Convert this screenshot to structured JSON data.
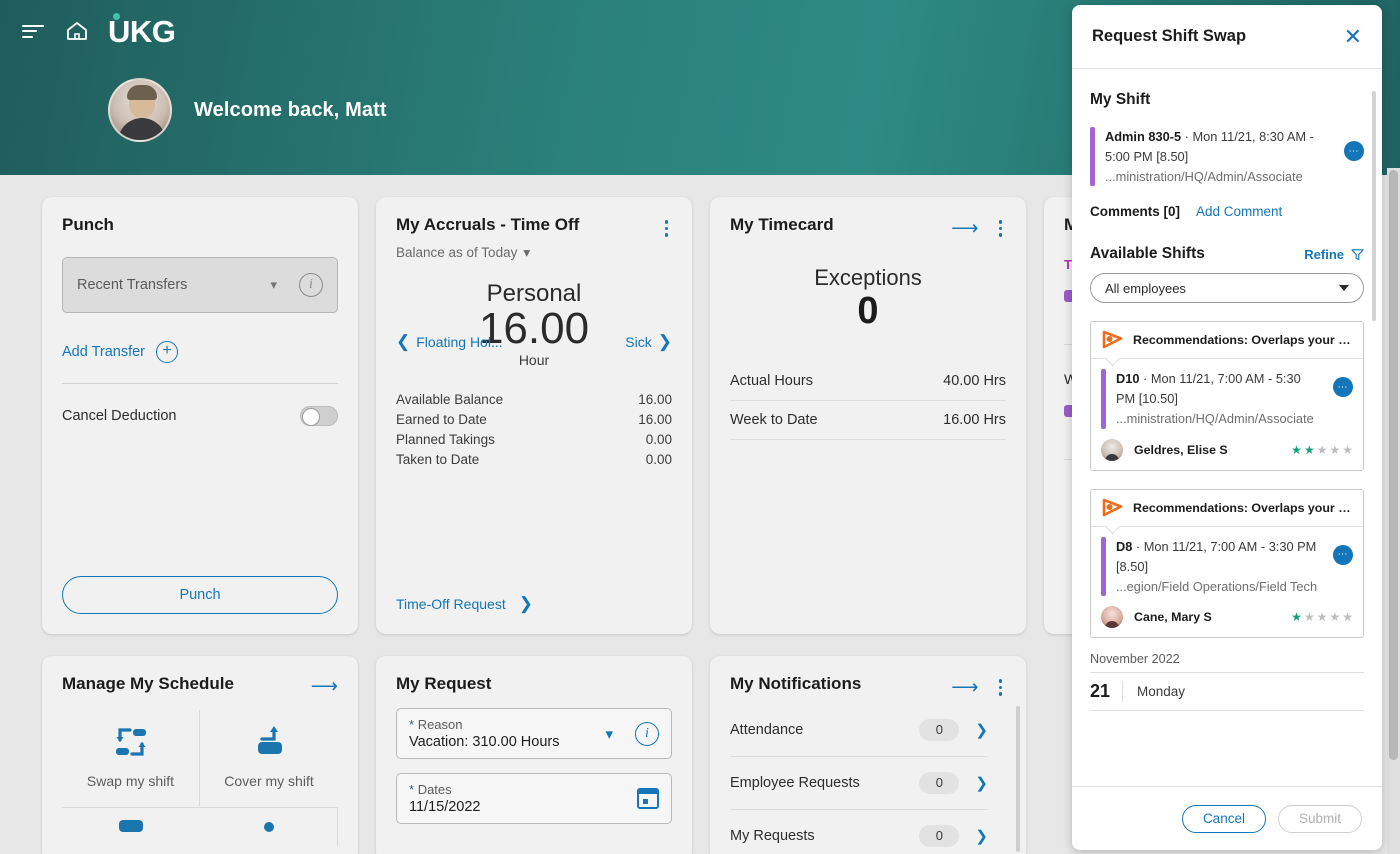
{
  "header": {
    "logo": "UKG",
    "menu_icon": "hamburger-icon",
    "home_icon": "home-icon",
    "welcome": "Welcome back, Matt"
  },
  "cards": {
    "punch": {
      "title": "Punch",
      "transfer_select": "Recent Transfers",
      "add_transfer": "Add Transfer",
      "cancel_deduction": "Cancel Deduction",
      "punch_button": "Punch"
    },
    "accruals": {
      "title": "My Accruals - Time Off",
      "subtitle": "Balance as of Today",
      "accrual_name": "Personal",
      "accrual_value": "16.00",
      "accrual_unit": "Hour",
      "prev_label": "Floating Hol...",
      "next_label": "Sick",
      "rows": [
        {
          "label": "Available Balance",
          "value": "16.00"
        },
        {
          "label": "Earned to Date",
          "value": "16.00"
        },
        {
          "label": "Planned Takings",
          "value": "0.00"
        },
        {
          "label": "Taken to Date",
          "value": "0.00"
        }
      ],
      "footer_link": "Time-Off Request"
    },
    "timecard": {
      "title": "My Timecard",
      "exceptions_label": "Exceptions",
      "exceptions_count": "0",
      "rows": [
        {
          "label": "Actual Hours",
          "value": "40.00 Hrs"
        },
        {
          "label": "Week to Date",
          "value": "16.00 Hrs"
        }
      ]
    },
    "card4": {
      "title": "My",
      "today_label": "TO",
      "week_label": "WE"
    },
    "schedule": {
      "title": "Manage My Schedule",
      "tiles": [
        {
          "label": "Swap my shift",
          "icon": "swap-shift-icon"
        },
        {
          "label": "Cover my shift",
          "icon": "cover-shift-icon"
        }
      ]
    },
    "request": {
      "title": "My Request",
      "reason_label": "Reason",
      "reason_value": "Vacation: 310.00 Hours",
      "dates_label": "Dates",
      "dates_value": "11/15/2022"
    },
    "notifications": {
      "title": "My Notifications",
      "items": [
        {
          "label": "Attendance",
          "count": "0"
        },
        {
          "label": "Employee Requests",
          "count": "0"
        },
        {
          "label": "My Requests",
          "count": "0"
        }
      ]
    }
  },
  "panel": {
    "title": "Request Shift Swap",
    "close_icon": "close-icon",
    "my_shift_title": "My Shift",
    "my_shift": {
      "code": "Admin 830-5",
      "detail": " · Mon 11/21, 8:30 AM - 5:00 PM [8.50]",
      "path": "...ministration/HQ/Admin/Associate"
    },
    "comments_label": "Comments [0]",
    "add_comment": "Add Comment",
    "available_title": "Available Shifts",
    "refine": "Refine",
    "employee_filter": "All employees",
    "shift_cards": [
      {
        "banner": "Recommendations: Overlaps your pr...",
        "code": "D10",
        "detail": " · Mon 11/21, 7:00 AM - 5:30 PM [10.50]",
        "path": "...ministration/HQ/Admin/Associate",
        "employee": "Geldres, Elise S",
        "rating": 2,
        "max_rating": 5
      },
      {
        "banner": "Recommendations: Overlaps your pr...",
        "code": "D8",
        "detail": " · Mon 11/21, 7:00 AM - 3:30 PM [8.50]",
        "path": "...egion/Field Operations/Field Tech",
        "employee": "Cane, Mary S",
        "rating": 1,
        "max_rating": 5
      }
    ],
    "month_label": "November 2022",
    "day_number": "21",
    "day_name": "Monday",
    "cancel_button": "Cancel",
    "submit_button": "Submit"
  },
  "colors": {
    "header_teal": "#2a7e79",
    "accent_blue": "#1476b8",
    "shift_purple": "#a463d4",
    "star_green": "#13a07b",
    "flag_orange": "#ef6c1a",
    "today_magenta": "#b431b4"
  }
}
